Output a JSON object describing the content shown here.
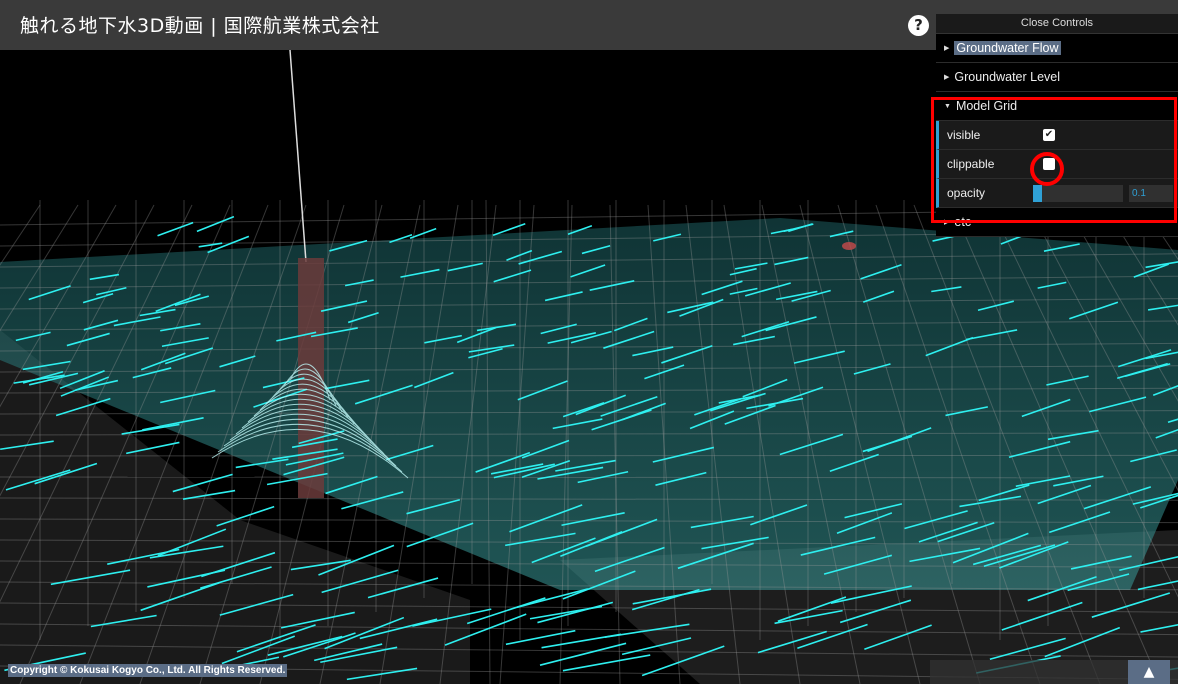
{
  "header": {
    "title": "触れる地下水3D動画 | 国際航業株式会社",
    "help_label": "?"
  },
  "controls": {
    "close_label": "Close Controls",
    "folders": [
      {
        "label": "Groundwater Flow"
      },
      {
        "label": "Groundwater Level"
      },
      {
        "label": "Model Grid"
      },
      {
        "label": "etc"
      }
    ],
    "model_grid": {
      "visible_label": "visible",
      "visible_checked": true,
      "clippable_label": "clippable",
      "clippable_checked": false,
      "opacity_label": "opacity",
      "opacity_value": "0.1"
    }
  },
  "footer": {
    "copyright": "Copyright © Kokusai Kogyo Co., Ltd. All Rights Reserved.",
    "top_button_icon": "triangle-up-icon"
  },
  "colors": {
    "flow": "#2ef0f0",
    "accent": "#2fa1d6",
    "highlight_box": "#ff0000"
  }
}
